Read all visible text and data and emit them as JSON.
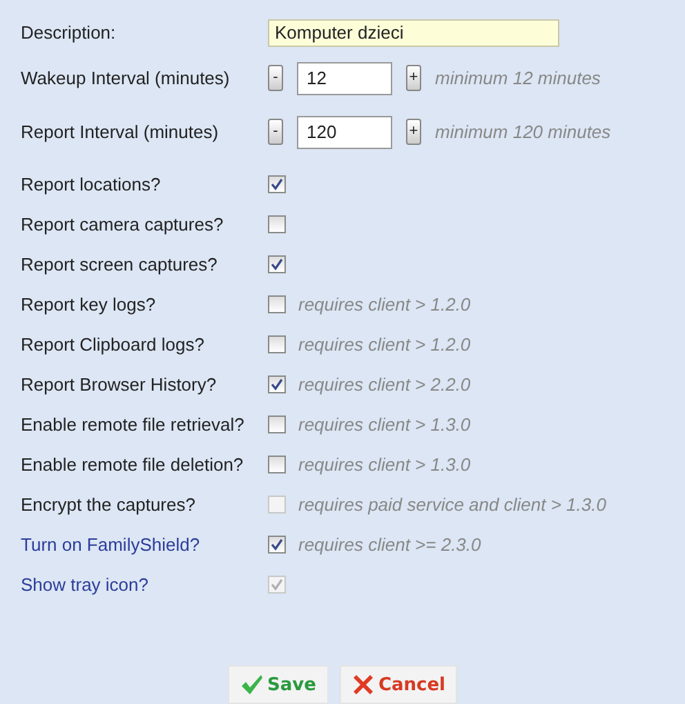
{
  "description": {
    "label": "Description:",
    "value": "Komputer dzieci"
  },
  "intervals": [
    {
      "label": "Wakeup Interval (minutes)",
      "minus": "-",
      "value": "12",
      "plus": "+",
      "hint": "minimum 12 minutes"
    },
    {
      "label": "Report Interval (minutes)",
      "minus": "-",
      "value": "120",
      "plus": "+",
      "hint": "minimum 120 minutes"
    }
  ],
  "options": [
    {
      "label": "Report locations?",
      "checked": true,
      "disabled": false,
      "highlighted": false
    },
    {
      "label": "Report camera captures?",
      "checked": false,
      "disabled": false,
      "highlighted": false
    },
    {
      "label": "Report screen captures?",
      "checked": true,
      "disabled": false,
      "highlighted": false
    },
    {
      "label": "Report key logs?",
      "checked": false,
      "disabled": false,
      "highlighted": false,
      "note": "requires client > 1.2.0"
    },
    {
      "label": "Report Clipboard logs?",
      "checked": false,
      "disabled": false,
      "highlighted": false,
      "note": "requires client > 1.2.0"
    },
    {
      "label": "Report Browser History?",
      "checked": true,
      "disabled": false,
      "highlighted": false,
      "note": "requires client > 2.2.0"
    },
    {
      "label": "Enable remote file retrieval?",
      "checked": false,
      "disabled": false,
      "highlighted": false,
      "note": "requires client > 1.3.0"
    },
    {
      "label": "Enable remote file deletion?",
      "checked": false,
      "disabled": false,
      "highlighted": false,
      "note": "requires client > 1.3.0"
    },
    {
      "label": "Encrypt the captures?",
      "checked": false,
      "disabled": true,
      "highlighted": false,
      "note": "requires paid service and client > 1.3.0"
    },
    {
      "label": "Turn on FamilyShield?",
      "checked": true,
      "disabled": false,
      "highlighted": true,
      "note": "requires client >= 2.3.0"
    },
    {
      "label": "Show tray icon?",
      "checked": true,
      "disabled": true,
      "highlighted": true
    }
  ],
  "buttons": [
    {
      "kind": "save",
      "label": "Save"
    },
    {
      "kind": "cancel",
      "label": "Cancel"
    }
  ]
}
